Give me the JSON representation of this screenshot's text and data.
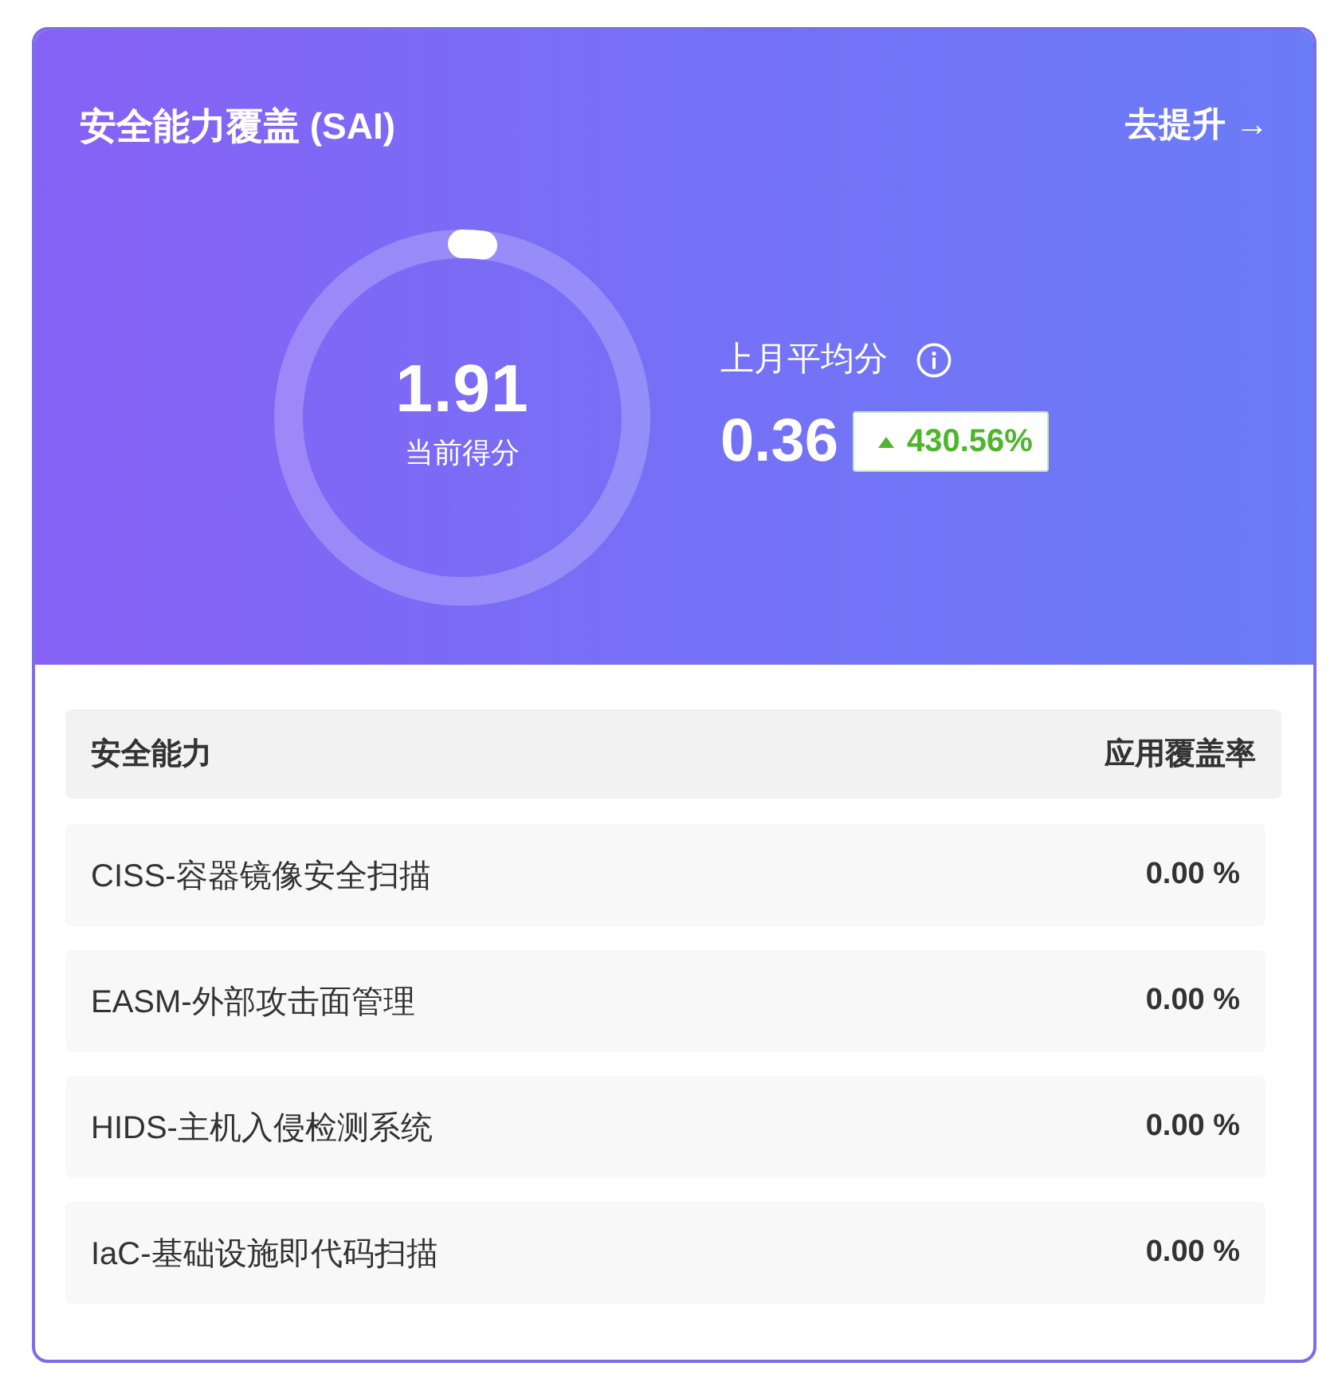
{
  "card": {
    "title": "安全能力覆盖 (SAI)",
    "action": "去提升 →"
  },
  "score": {
    "value": "1.91",
    "label": "当前得分",
    "level": 0.0191
  },
  "last_month": {
    "label": "上月平均分",
    "value": "0.36",
    "change": "430.56%",
    "rising": true
  },
  "table": {
    "columns": [
      "安全能力",
      "应用覆盖率"
    ],
    "rows": [
      {
        "name": "CISS-容器镜像安全扫描",
        "rate": "0.00 %"
      },
      {
        "name": "EASM-外部攻击面管理",
        "rate": "0.00 %"
      },
      {
        "name": "HIDS-主机入侵检测系统",
        "rate": "0.00 %"
      },
      {
        "name": "IaC-基础设施即代码扫描",
        "rate": "0.00 %"
      }
    ]
  }
}
